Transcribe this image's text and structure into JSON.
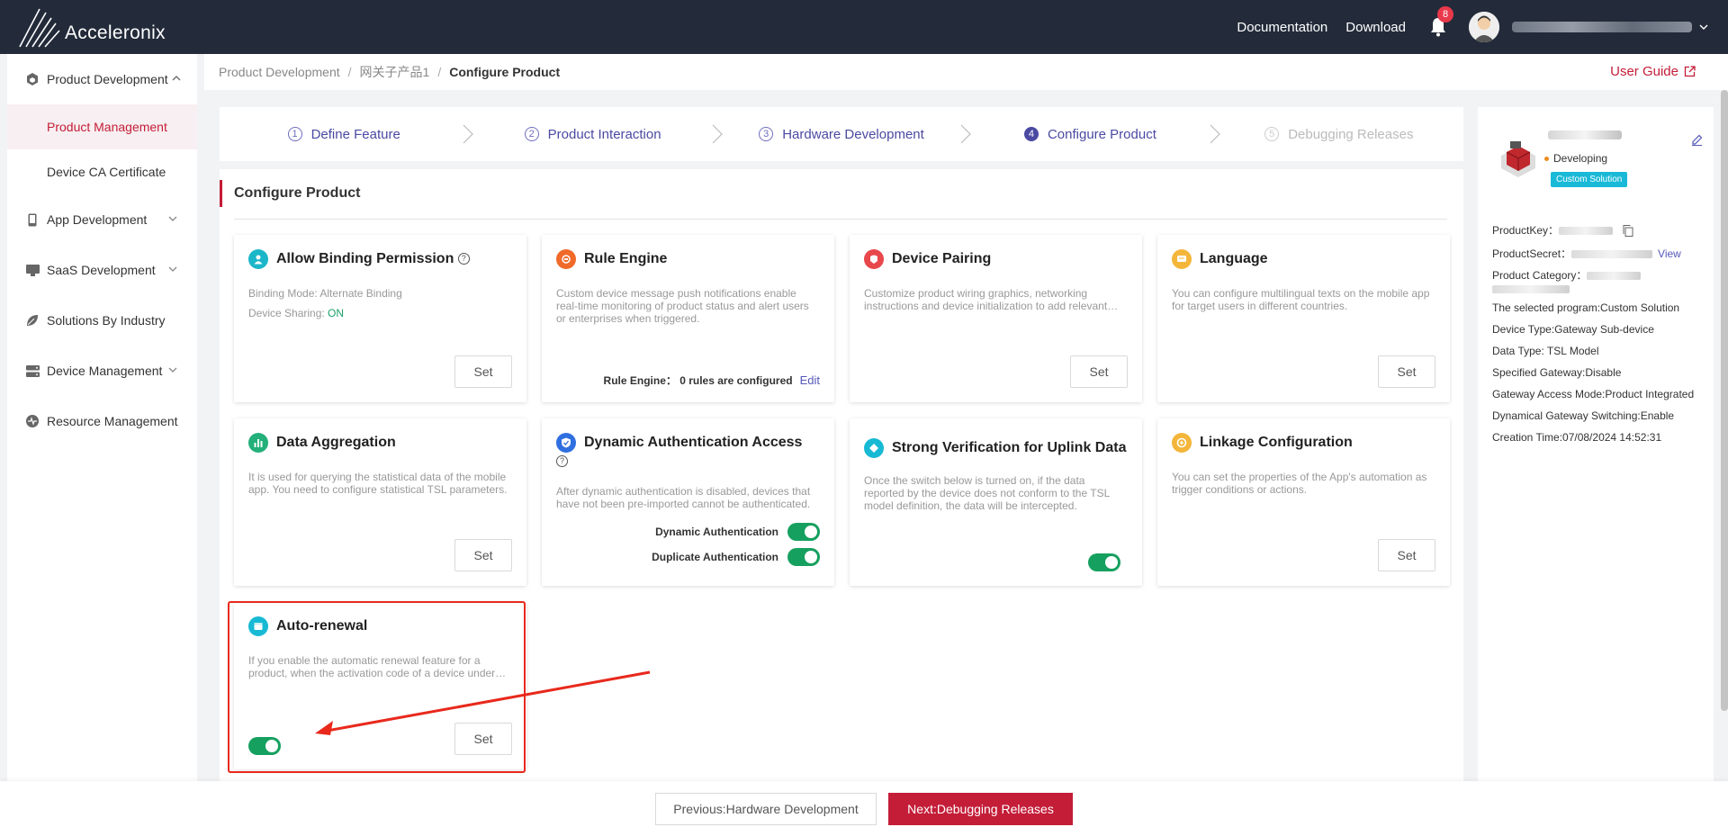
{
  "header": {
    "brand": "Acceleronix",
    "links": [
      "Documentation",
      "Download"
    ],
    "notification_count": "8"
  },
  "sidebar": {
    "items": [
      {
        "label": "Product Development",
        "expanded": true,
        "icon": "cube-icon"
      },
      {
        "label": "Product Management",
        "sub": true,
        "active": true
      },
      {
        "label": "Device CA Certificate",
        "sub": true
      },
      {
        "label": "App Development",
        "icon": "phone-icon"
      },
      {
        "label": "SaaS Development",
        "icon": "monitor-icon"
      },
      {
        "label": "Solutions By Industry",
        "icon": "leaf-icon"
      },
      {
        "label": "Device Management",
        "icon": "server-icon"
      },
      {
        "label": "Resource Management",
        "icon": "pulse-icon"
      }
    ]
  },
  "breadcrumb": {
    "items": [
      "Product Development",
      "网关子产品1",
      "Configure Product"
    ],
    "user_guide": "User Guide"
  },
  "steps": [
    {
      "num": "1",
      "label": "Define Feature"
    },
    {
      "num": "2",
      "label": "Product Interaction"
    },
    {
      "num": "3",
      "label": "Hardware Development"
    },
    {
      "num": "4",
      "label": "Configure Product",
      "active": true
    },
    {
      "num": "5",
      "label": "Debugging Releases",
      "disabled": true
    }
  ],
  "section_title": "Configure Product",
  "cards": {
    "binding": {
      "title": "Allow Binding Permission",
      "binding_mode": "Binding Mode: Alternate Binding",
      "device_sharing_label": "Device Sharing: ",
      "device_sharing_value": "ON",
      "button": "Set"
    },
    "rule_engine": {
      "title": "Rule Engine",
      "desc": "Custom device message push notifications enable real-time monitoring of product status and alert users or enterprises when triggered.",
      "footer_label": "Rule Engine：  0 rules are configured",
      "edit": "Edit"
    },
    "pairing": {
      "title": "Device Pairing",
      "desc": "Customize product wiring graphics, networking instructions and device initialization to add relevant…",
      "button": "Set"
    },
    "language": {
      "title": "Language",
      "desc": "You can configure multilingual texts on the mobile app for target users in different countries.",
      "button": "Set"
    },
    "aggregation": {
      "title": "Data Aggregation",
      "desc": "It is used for querying the statistical data of the mobile app. You need to configure statistical TSL parameters.",
      "button": "Set"
    },
    "dyn_auth": {
      "title": "Dynamic Authentication Access",
      "desc": "After dynamic authentication is disabled, devices that have not been pre-imported cannot be authenticated.",
      "row1": "Dynamic Authentication",
      "row2": "Duplicate Authentication",
      "row1_on": true,
      "row2_on": true
    },
    "strong_verify": {
      "title": "Strong Verification for Uplink Data",
      "desc": "Once the switch below is turned on, if the data reported by the device does not conform to the TSL model definition, the data will be intercepted.",
      "switch_on": true
    },
    "linkage": {
      "title": "Linkage Configuration",
      "desc": "You can set the properties of the App's automation as trigger conditions or actions.",
      "button": "Set"
    },
    "auto_renewal": {
      "title": "Auto-renewal",
      "desc": "If you enable the automatic renewal feature for a product, when the activation code of a device under…",
      "button": "Set",
      "switch_on": true
    }
  },
  "product_panel": {
    "status": "Developing",
    "tag": "Custom Solution",
    "fields": {
      "product_key": "ProductKey：",
      "product_secret": "ProductSecret：",
      "view": "View",
      "category": "Product Category：",
      "program": "The selected program:Custom Solution",
      "device_type": "Device Type:Gateway Sub-device",
      "data_type": "Data Type: TSL Model",
      "gateway": "Specified Gateway:Disable",
      "access_mode": "Gateway Access Mode:Product Integrated",
      "switching": "Dynamical Gateway Switching:Enable",
      "created": "Creation Time:07/08/2024 14:52:31"
    }
  },
  "footer": {
    "prev": "Previous:Hardware Development",
    "next": "Next:Debugging Releases"
  },
  "colors": {
    "brand_red": "#c41d38",
    "topbar": "#232b3a",
    "toggle_on": "#16a05f",
    "annotation": "#e8291c"
  }
}
